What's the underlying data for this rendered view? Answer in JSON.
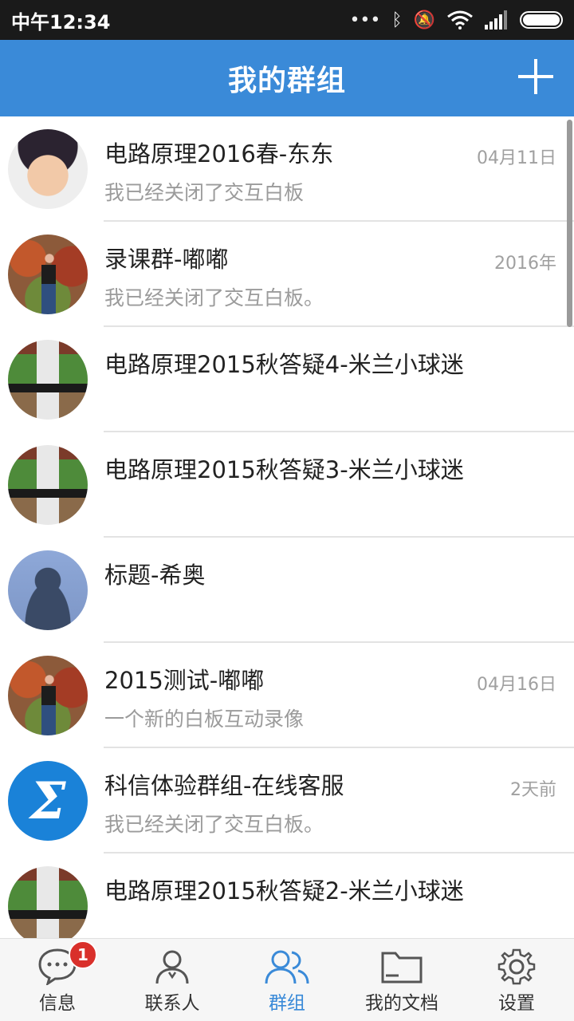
{
  "status_bar": {
    "time": "中午12:34"
  },
  "app_bar": {
    "title": "我的群组"
  },
  "groups": [
    {
      "name": "电路原理2016春-东东",
      "subtitle": "我已经关闭了交互白板",
      "date": "04月11日",
      "avatar": "face-photo"
    },
    {
      "name": "录课群-嘟嘟",
      "subtitle": "我已经关闭了交互白板。",
      "date": "2016年",
      "avatar": "autumn-photo"
    },
    {
      "name": "电路原理2015秋答疑4-米兰小球迷",
      "subtitle": "",
      "date": "",
      "avatar": "soccer-photo"
    },
    {
      "name": "电路原理2015秋答疑3-米兰小球迷",
      "subtitle": "",
      "date": "",
      "avatar": "soccer-photo"
    },
    {
      "name": "标题-希奥",
      "subtitle": "",
      "date": "",
      "avatar": "default-avatar"
    },
    {
      "name": "2015测试-嘟嘟",
      "subtitle": "一个新的白板互动录像",
      "date": "04月16日",
      "avatar": "autumn-photo"
    },
    {
      "name": "科信体验群组-在线客服",
      "subtitle": "我已经关闭了交互白板。",
      "date": "2天前",
      "avatar": "sigma-logo"
    },
    {
      "name": "电路原理2015秋答疑2-米兰小球迷",
      "subtitle": "",
      "date": "",
      "avatar": "soccer-photo"
    }
  ],
  "sigma_glyph": "Σ",
  "tabs": [
    {
      "label": "信息",
      "icon": "chat-bubble-icon",
      "badge": "1"
    },
    {
      "label": "联系人",
      "icon": "contact-icon"
    },
    {
      "label": "群组",
      "icon": "group-icon",
      "active": true
    },
    {
      "label": "我的文档",
      "icon": "folder-icon"
    },
    {
      "label": "设置",
      "icon": "gear-icon"
    }
  ],
  "colors": {
    "primary": "#3a8ad8",
    "badge": "#d9302b"
  }
}
